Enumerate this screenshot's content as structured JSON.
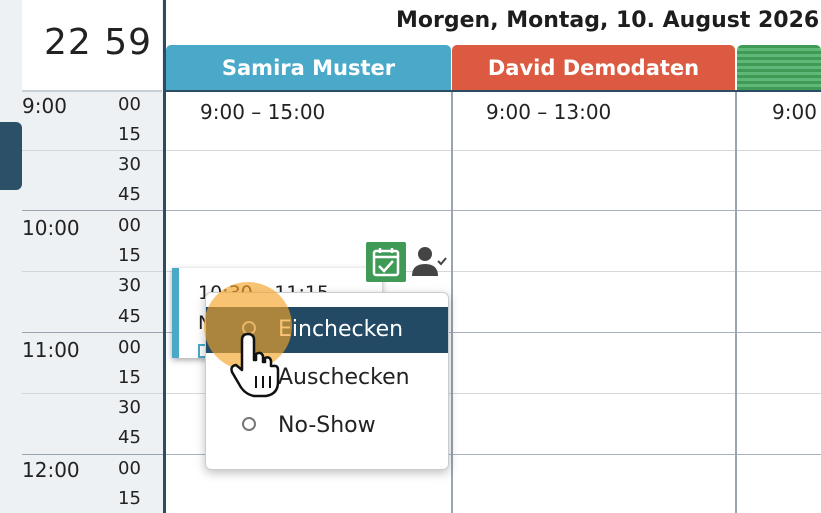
{
  "clock": {
    "time": "22 59"
  },
  "header": {
    "date": "Morgen, Montag, 10. August 2026"
  },
  "staff": [
    {
      "name": "Samira Muster",
      "color": "#4aa9c8",
      "shift": "9:00 – 15:00"
    },
    {
      "name": "David Demodaten",
      "color": "#dc5a41",
      "shift": "9:00 – 13:00"
    },
    {
      "name": "",
      "color": "#3e9a55",
      "shift": "9:00"
    }
  ],
  "time_rows": [
    {
      "hour": "9:00",
      "minutes": [
        "00",
        "15",
        "30",
        "45"
      ]
    },
    {
      "hour": "10:00",
      "minutes": [
        "00",
        "15",
        "30",
        "45"
      ]
    },
    {
      "hour": "11:00",
      "minutes": [
        "00",
        "15",
        "30",
        "45"
      ]
    },
    {
      "hour": "12:00",
      "minutes": [
        "00",
        "15"
      ]
    }
  ],
  "appointment": {
    "time": "10:30 – 11:15",
    "name": "N"
  },
  "context_menu": {
    "items": [
      {
        "label": "Einchecken",
        "selected": true
      },
      {
        "label": "Auschecken",
        "selected": false
      },
      {
        "label": "No-Show",
        "selected": false
      }
    ]
  },
  "icons": {
    "checkin": "calendar-check-icon",
    "person": "person-check-icon",
    "cursor": "hand-pointer-icon"
  },
  "colors": {
    "accent": "#234a64",
    "highlight": "#f5a528"
  }
}
